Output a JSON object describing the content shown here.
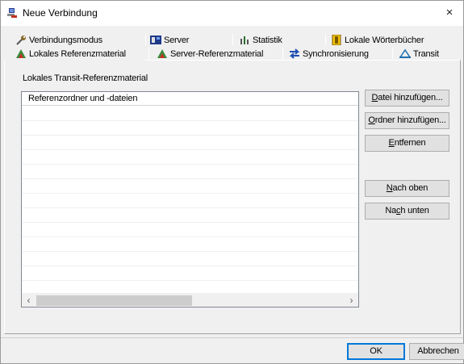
{
  "window": {
    "title": "Neue Verbindung",
    "close_glyph": "×",
    "icon": "network-connection-icon"
  },
  "tabs": {
    "back_row": [
      {
        "label": "Verbindungsmodus",
        "icon": "wrench-icon"
      },
      {
        "label": "Server",
        "icon": "server-icon"
      },
      {
        "label": "Statistik",
        "icon": "statistics-icon"
      },
      {
        "label": "Lokale Wörterbücher",
        "icon": "dictionary-icon"
      }
    ],
    "front_row": [
      {
        "label": "Lokales Referenzmaterial",
        "icon": "local-reference-icon",
        "active": true
      },
      {
        "label": "Server-Referenzmaterial",
        "icon": "server-reference-icon"
      },
      {
        "label": "Synchronisierung",
        "icon": "sync-arrows-icon"
      },
      {
        "label": "Transit",
        "icon": "transit-icon"
      }
    ]
  },
  "panel": {
    "group_label": "Lokales Transit-Referenzmaterial",
    "list": {
      "column_header": "Referenzordner und -dateien",
      "rows": [],
      "scroll_left_glyph": "‹",
      "scroll_right_glyph": "›"
    },
    "buttons": {
      "add_file": {
        "hotkey": "D",
        "rest": "atei hinzufügen..."
      },
      "add_folder": {
        "hotkey": "O",
        "rest": "rdner hinzufügen..."
      },
      "remove": {
        "hotkey": "E",
        "rest": "ntfernen"
      },
      "move_up": {
        "hotkey": "N",
        "rest": "ach oben"
      },
      "move_down": {
        "pre": "Na",
        "hotkey": "c",
        "rest": "h unten"
      }
    }
  },
  "footer": {
    "ok_label": "OK",
    "cancel_label": "Abbrechen"
  },
  "colors": {
    "dialog_bg": "#f0f0f0",
    "button_bg": "#e1e1e1",
    "default_button_border": "#0078d7"
  }
}
